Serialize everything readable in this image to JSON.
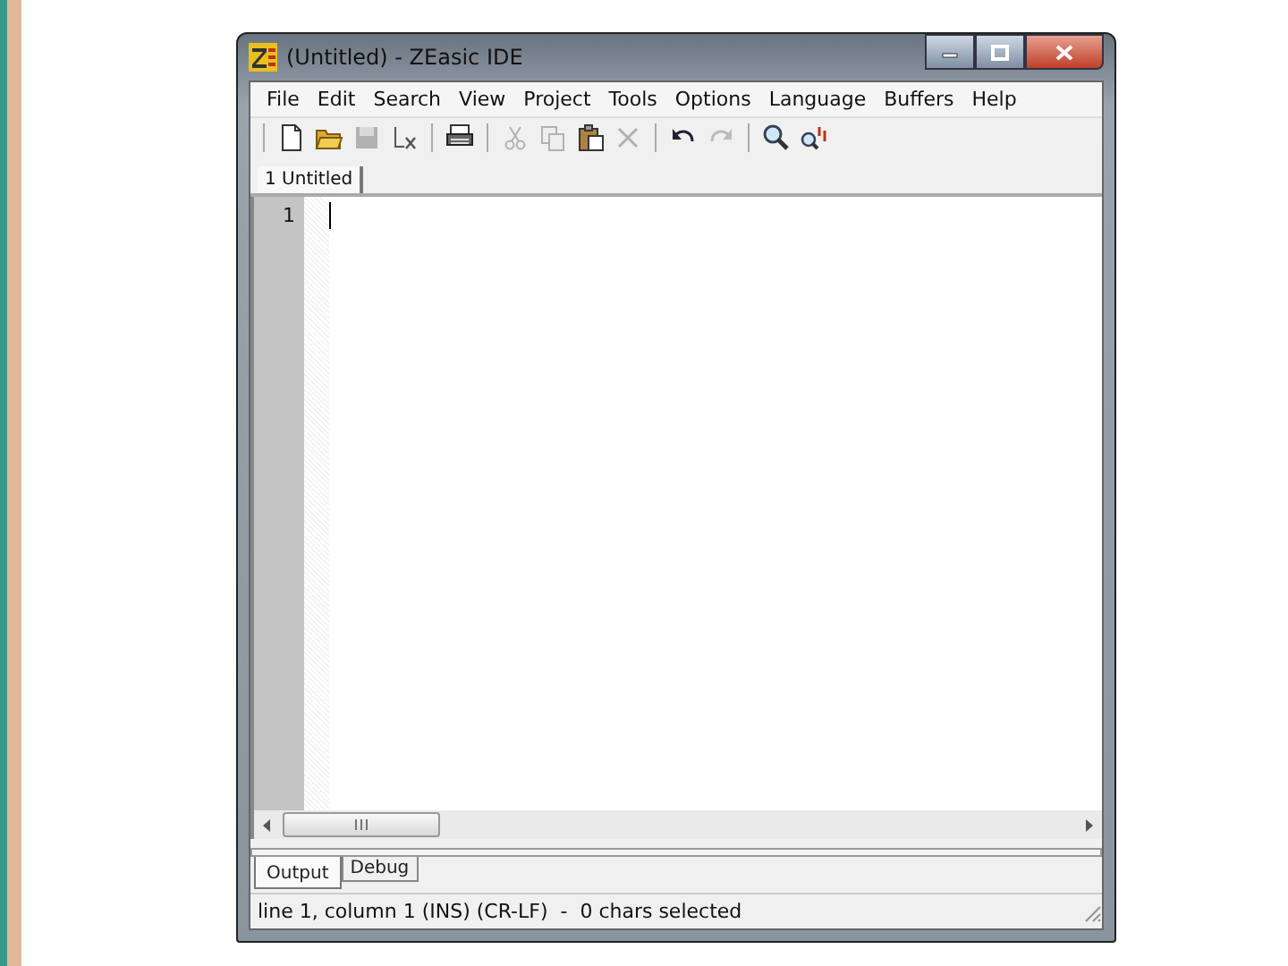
{
  "window": {
    "title": "(Untitled) - ZEasic IDE"
  },
  "menu": [
    "File",
    "Edit",
    "Search",
    "View",
    "Project",
    "Tools",
    "Options",
    "Language",
    "Buffers",
    "Help"
  ],
  "toolbar": [
    {
      "kind": "new",
      "disabled": false
    },
    {
      "kind": "open",
      "disabled": false
    },
    {
      "kind": "save",
      "disabled": true
    },
    {
      "kind": "close",
      "disabled": false
    },
    {
      "kind": "sep"
    },
    {
      "kind": "print",
      "disabled": false
    },
    {
      "kind": "sep"
    },
    {
      "kind": "cut",
      "disabled": true
    },
    {
      "kind": "copy",
      "disabled": true
    },
    {
      "kind": "paste",
      "disabled": false
    },
    {
      "kind": "delete",
      "disabled": true
    },
    {
      "kind": "sep"
    },
    {
      "kind": "undo",
      "disabled": false
    },
    {
      "kind": "redo",
      "disabled": true
    },
    {
      "kind": "sep"
    },
    {
      "kind": "find",
      "disabled": false
    },
    {
      "kind": "replace",
      "disabled": false
    }
  ],
  "document_tabs": [
    {
      "label": "1 Untitled",
      "selected": true
    }
  ],
  "editor": {
    "line_numbers": [
      "1"
    ]
  },
  "bottom_tabs": [
    {
      "label": "Output",
      "selected": true
    },
    {
      "label": "Debug",
      "selected": false
    }
  ],
  "status_bar": "line 1, column 1 (INS) (CR-LF)  -  0 chars selected"
}
